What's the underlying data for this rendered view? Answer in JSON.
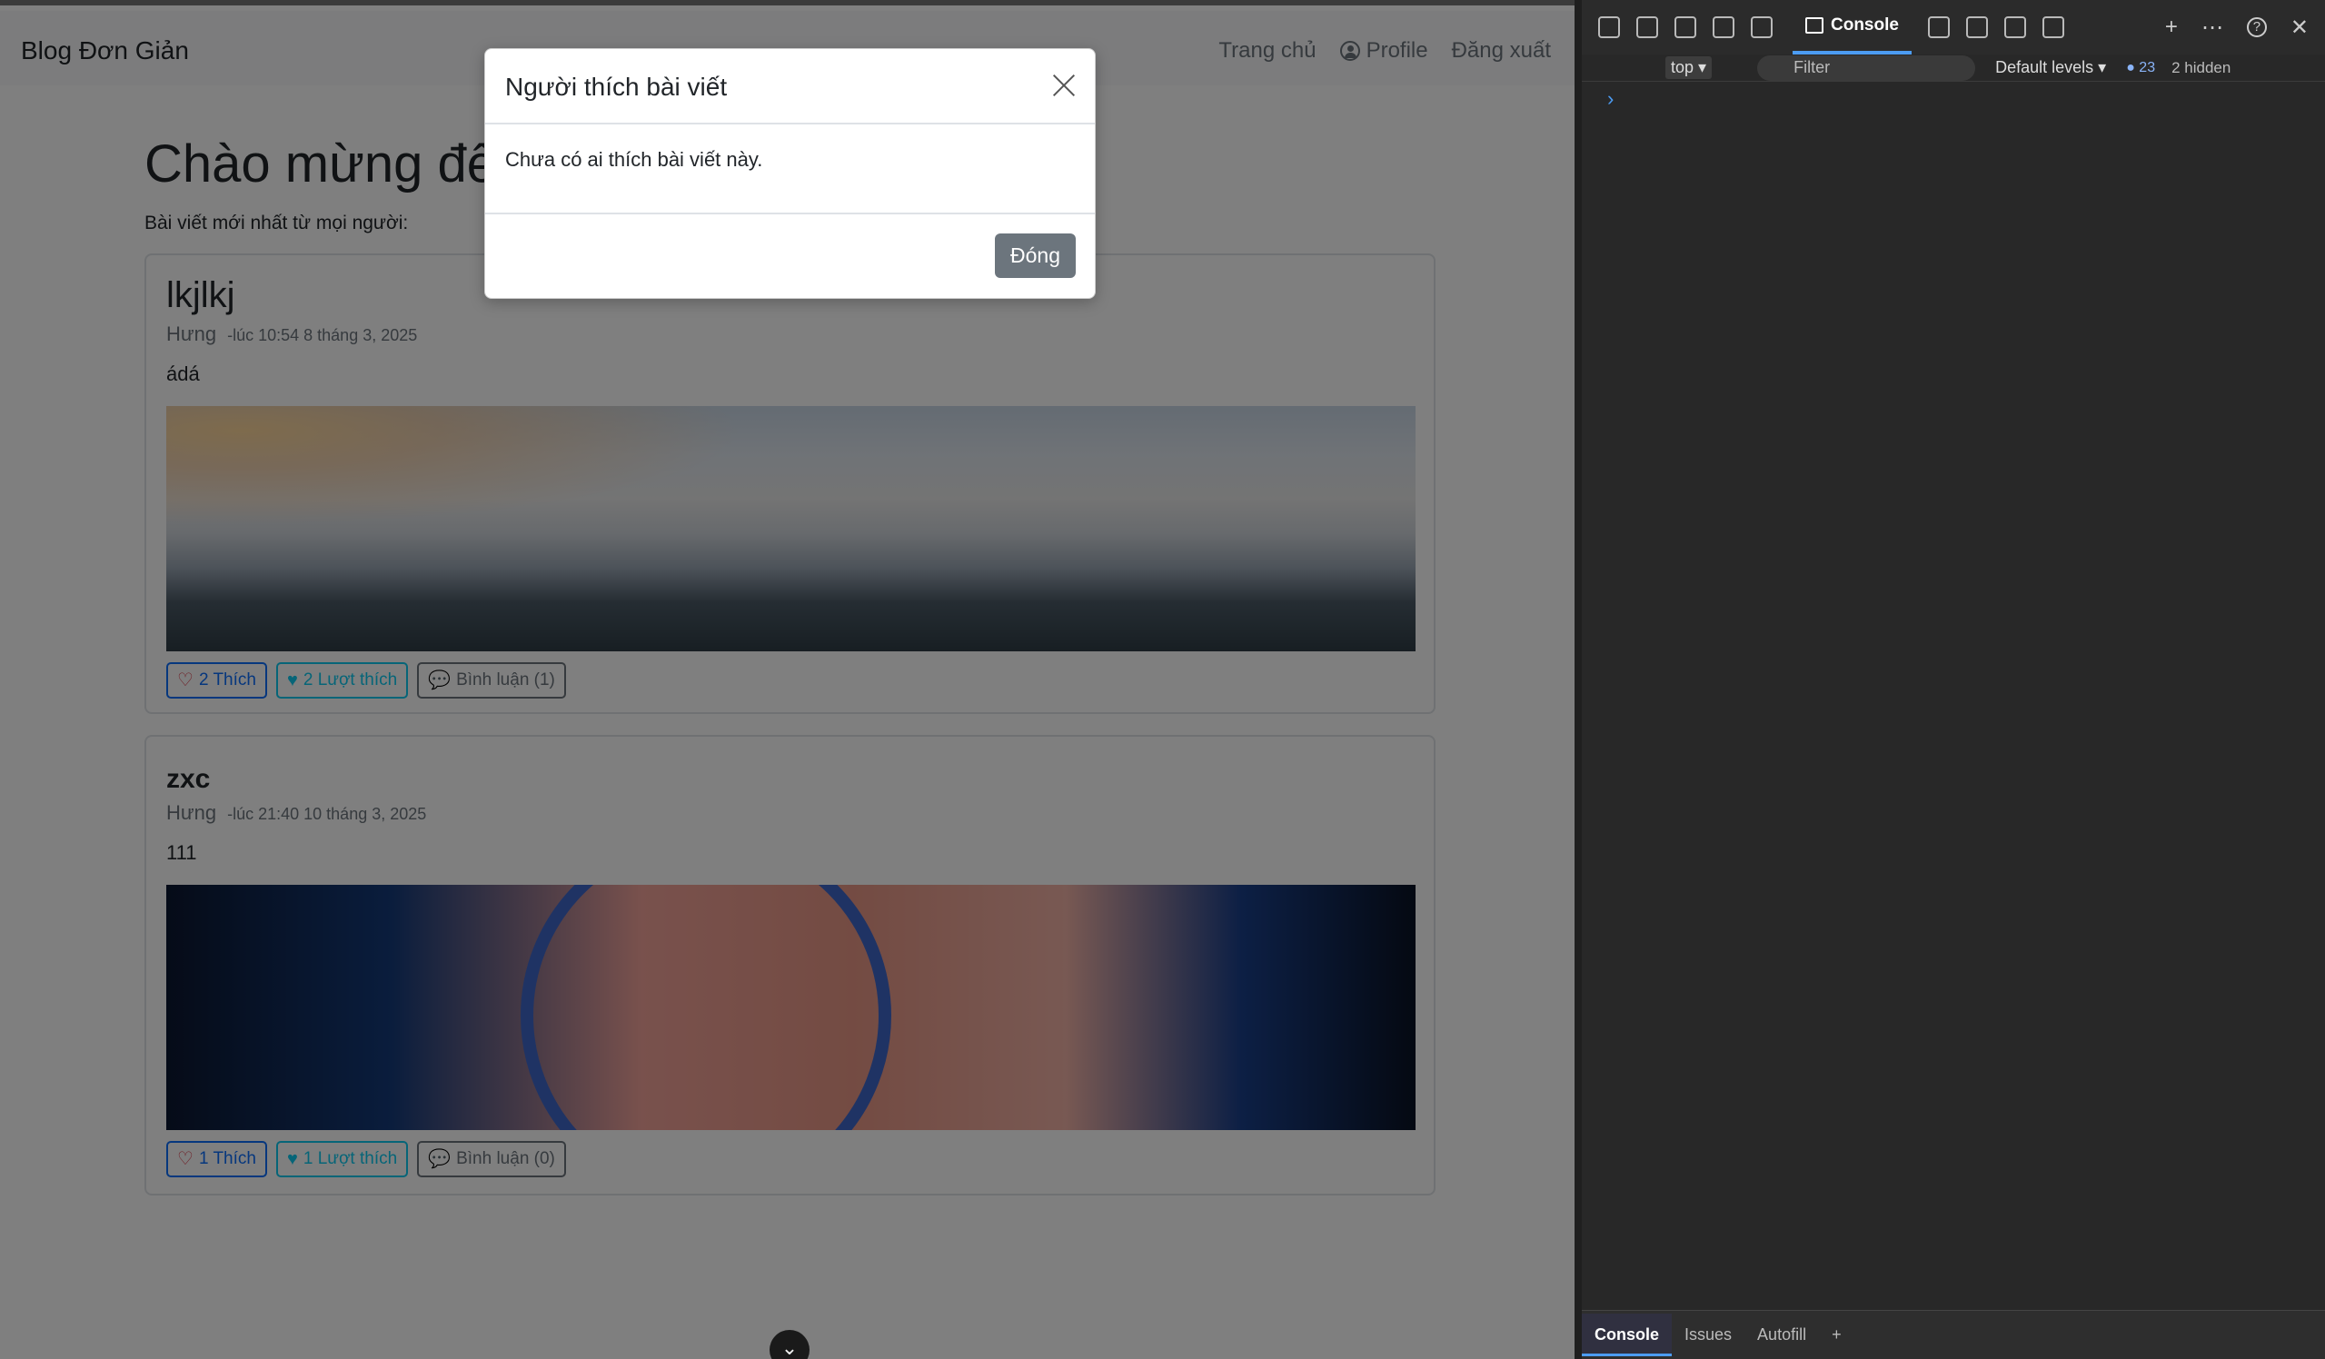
{
  "navbar": {
    "brand": "Blog Đơn Giản",
    "home": "Trang chủ",
    "profile": "Profile",
    "logout": "Đăng xuất"
  },
  "main": {
    "welcome": "Chào mừng đến",
    "subtitle": "Bài viết mới nhất từ mọi người:"
  },
  "posts": [
    {
      "title": "lkjlkj",
      "author": "Hưng",
      "time": "-lúc 10:54 8 tháng 3, 2025",
      "body": "ádá",
      "like_label": "2 Thích",
      "likes_label": "2 Lượt thích",
      "comment_label": "Bình luận (1)"
    },
    {
      "title": "zxc",
      "author": "Hưng",
      "time": "-lúc 21:40 10 tháng 3, 2025",
      "body": "111",
      "like_label": "1 Thích",
      "likes_label": "1 Lượt thích",
      "comment_label": "Bình luận (0)"
    }
  ],
  "modal": {
    "title": "Người thích bài viết",
    "body": "Chưa có ai thích bài viết này.",
    "close_label": "Đóng"
  },
  "devtools": {
    "console_tab": "Console",
    "context": "top",
    "filter_placeholder": "Filter",
    "levels": "Default levels",
    "message_count": "23",
    "hidden": "2 hidden",
    "drawer_tabs": [
      "Console",
      "Issues",
      "Autofill"
    ]
  }
}
